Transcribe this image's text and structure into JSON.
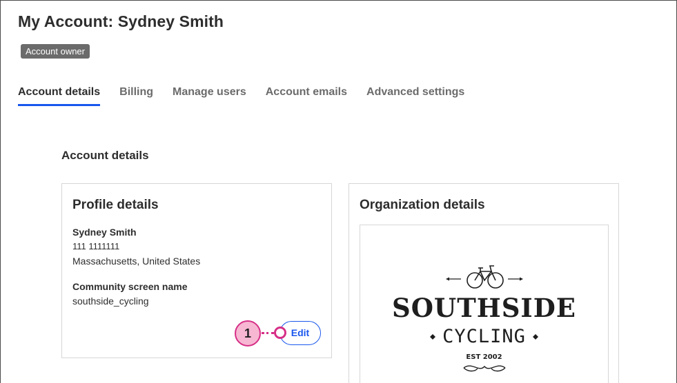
{
  "header": {
    "title": "My Account: Sydney Smith",
    "badge": "Account owner"
  },
  "tabs": [
    {
      "label": "Account details",
      "active": true
    },
    {
      "label": "Billing",
      "active": false
    },
    {
      "label": "Manage users",
      "active": false
    },
    {
      "label": "Account emails",
      "active": false
    },
    {
      "label": "Advanced settings",
      "active": false
    }
  ],
  "main": {
    "section_title": "Account details",
    "profile": {
      "title": "Profile details",
      "name": "Sydney Smith",
      "phone": "111 1111111",
      "location": "Massachusetts, United States",
      "screen_name_label": "Community screen name",
      "screen_name_value": "southside_cycling",
      "edit_label": "Edit"
    },
    "organization": {
      "title": "Organization details",
      "logo": {
        "word1": "SOUTHSIDE",
        "word2": "CYCLING",
        "est": "EST 2002"
      }
    }
  },
  "callout": {
    "number": "1"
  },
  "colors": {
    "accent": "#1856ed",
    "badge_bg": "#6b6b6b",
    "callout_fill": "#f7b6d2",
    "callout_stroke": "#d62f86"
  },
  "icons": [
    "bicycle-icon",
    "arrow-left-icon",
    "arrow-right-icon",
    "diamond-icon",
    "flourish-icon"
  ]
}
